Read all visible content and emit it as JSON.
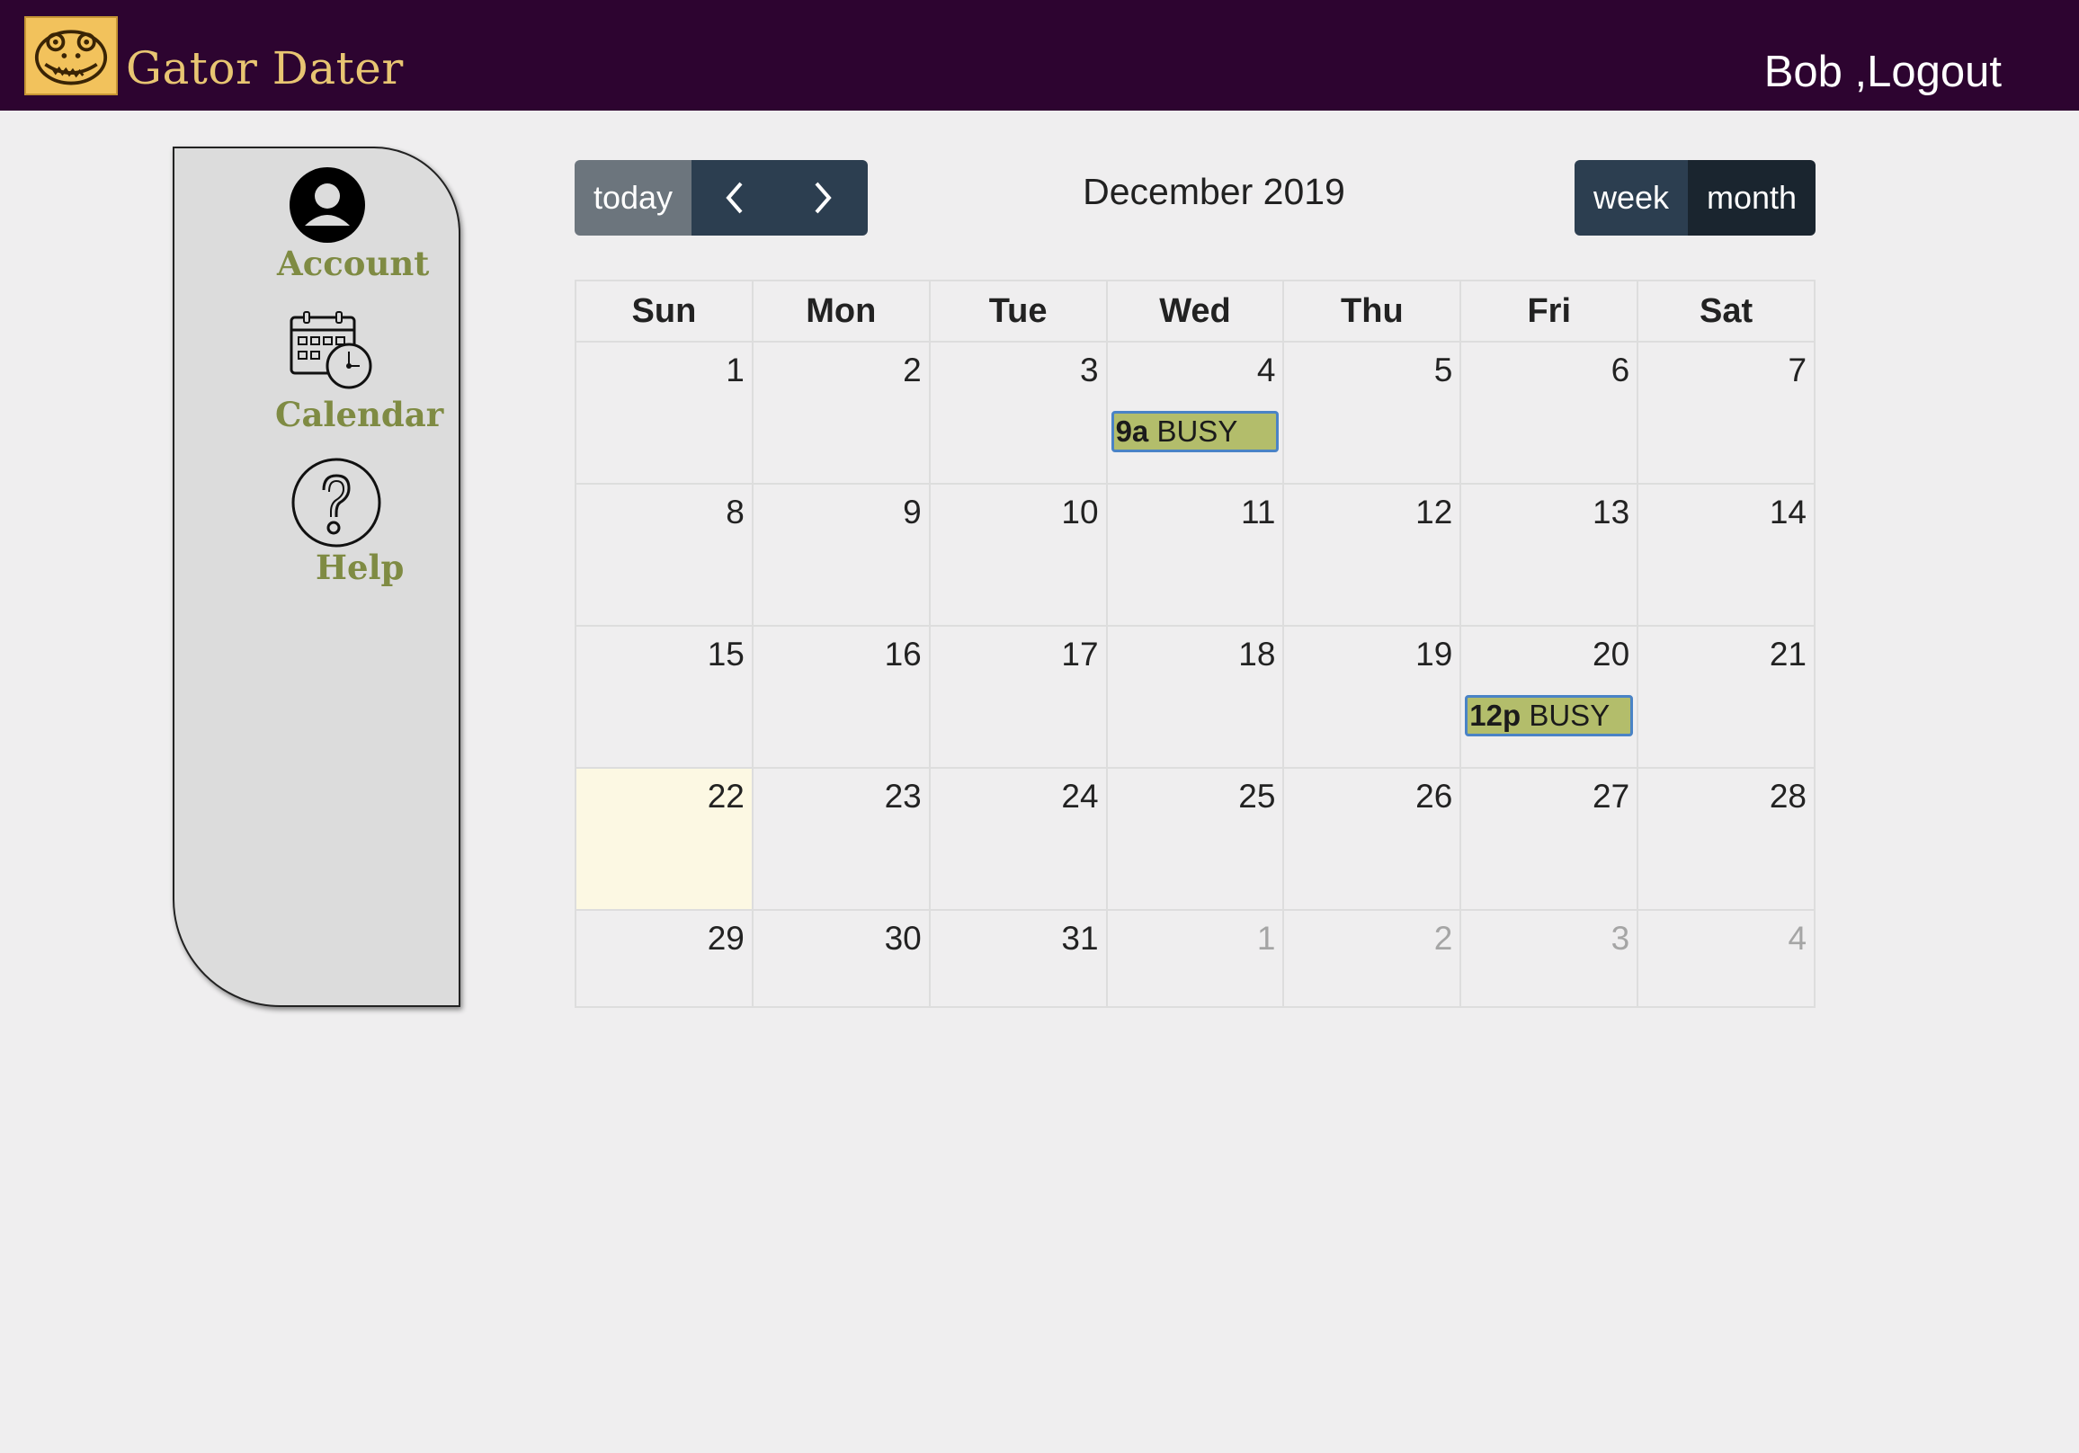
{
  "header": {
    "brand": "Gator Dater",
    "user_name": "Bob",
    "logout_label": ",Logout",
    "bg_color": "#2d0430"
  },
  "sidebar": {
    "items": [
      {
        "label": "Account",
        "icon": "account-icon"
      },
      {
        "label": "Calendar",
        "icon": "calendar-icon"
      },
      {
        "label": "Help",
        "icon": "help-icon"
      }
    ]
  },
  "toolbar": {
    "today_label": "today",
    "prev_icon": "chevron-left-icon",
    "next_icon": "chevron-right-icon",
    "title": "December 2019",
    "week_label": "week",
    "month_label": "month",
    "active_view": "month"
  },
  "calendar": {
    "day_headers": [
      "Sun",
      "Mon",
      "Tue",
      "Wed",
      "Thu",
      "Fri",
      "Sat"
    ],
    "weeks": [
      [
        {
          "n": "1"
        },
        {
          "n": "2"
        },
        {
          "n": "3"
        },
        {
          "n": "4",
          "event": {
            "time": "9a",
            "title": "BUSY"
          }
        },
        {
          "n": "5"
        },
        {
          "n": "6"
        },
        {
          "n": "7"
        }
      ],
      [
        {
          "n": "8"
        },
        {
          "n": "9"
        },
        {
          "n": "10"
        },
        {
          "n": "11"
        },
        {
          "n": "12"
        },
        {
          "n": "13"
        },
        {
          "n": "14"
        }
      ],
      [
        {
          "n": "15"
        },
        {
          "n": "16"
        },
        {
          "n": "17"
        },
        {
          "n": "18"
        },
        {
          "n": "19"
        },
        {
          "n": "20",
          "event": {
            "time": "12p",
            "title": "BUSY"
          }
        },
        {
          "n": "21"
        }
      ],
      [
        {
          "n": "22",
          "today": true
        },
        {
          "n": "23"
        },
        {
          "n": "24"
        },
        {
          "n": "25"
        },
        {
          "n": "26"
        },
        {
          "n": "27"
        },
        {
          "n": "28"
        }
      ],
      [
        {
          "n": "29"
        },
        {
          "n": "30"
        },
        {
          "n": "31"
        },
        {
          "n": "1",
          "other": true
        },
        {
          "n": "2",
          "other": true
        },
        {
          "n": "3",
          "other": true
        },
        {
          "n": "4",
          "other": true
        }
      ]
    ],
    "event_color": "#b3bd6b",
    "today_color": "#fcf8e3"
  }
}
